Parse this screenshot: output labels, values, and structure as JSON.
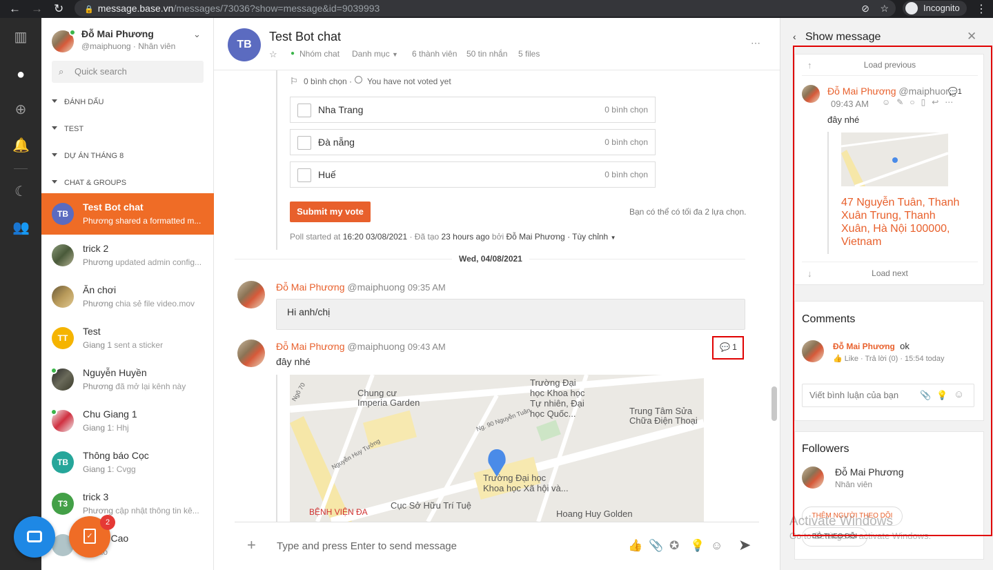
{
  "browser": {
    "url_host": "message.base.vn",
    "url_path": "/messages/73036?show=message&id=9039993",
    "incognito_label": "Incognito"
  },
  "user": {
    "name": "Đỗ Mai Phương",
    "handle": "@maiphuong · Nhân viên"
  },
  "search": {
    "placeholder": "Quick search"
  },
  "sections": [
    "ĐÁNH DẤU",
    "TEST",
    "DỰ ÁN THÁNG 8",
    "CHAT & GROUPS"
  ],
  "conversations": [
    {
      "initials": "TB",
      "name": "Test Bot chat",
      "sender": "Phương",
      "preview": " shared a formatted m...",
      "color": "#5b6bc0"
    },
    {
      "initials": "",
      "name": "trick 2",
      "sender": "Phương",
      "preview": " updated admin config...",
      "color": ""
    },
    {
      "initials": "",
      "name": "Ăn chơi",
      "sender": "Phương",
      "preview": " chia sẻ file video.mov",
      "color": ""
    },
    {
      "initials": "TT",
      "name": "Test",
      "sender": "Giang 1",
      "preview": " sent a sticker",
      "color": "#f5b400"
    },
    {
      "initials": "",
      "name": "Nguyễn Huyền",
      "sender": "Phương",
      "preview": " đã mở lại kênh này",
      "color": ""
    },
    {
      "initials": "",
      "name": "Chu Giang 1",
      "sender": "Giang 1",
      "preview": ": Hhj",
      "color": ""
    },
    {
      "initials": "TB",
      "name": "Thông báo Cọc",
      "sender": "Giang 1",
      "preview": ": Cvgg",
      "color": "#26a69a"
    },
    {
      "initials": "T3",
      "name": "trick 3",
      "sender": "Phương",
      "preview": " cập nhật thông tin kê...",
      "color": "#43a047"
    },
    {
      "initials": "",
      "name": "n Văn Cao",
      "sender": "ng",
      "preview": ": alo",
      "color": ""
    }
  ],
  "fab": {
    "badge": "2"
  },
  "chat": {
    "initials": "TB",
    "title": "Test Bot chat",
    "type": "Nhóm chat",
    "category": "Danh mục",
    "members": "6 thành viên",
    "messages": "50 tin nhắn",
    "files": "5 files"
  },
  "poll": {
    "summary_votes": "0 bình chọn ·",
    "summary_status": "You have not voted yet",
    "options": [
      {
        "label": "Nha Trang",
        "count": "0 bình chọn"
      },
      {
        "label": "Đà nẵng",
        "count": "0 bình chọn"
      },
      {
        "label": "Huế",
        "count": "0 bình chọn"
      }
    ],
    "submit": "Submit my vote",
    "hint": "Bạn có thể có tối đa 2 lựa chọn.",
    "started_prefix": "Poll started at ",
    "started_time": "16:20 03/08/2021",
    "created_prefix": " · Đã tạo ",
    "created_ago": "23 hours ago",
    "by": " bởi ",
    "author": "Đỗ Mai Phương",
    "customize": " · Tùy chỉnh"
  },
  "date_divider": "Wed, 04/08/2021",
  "messages": [
    {
      "author": "Đỗ Mai Phương",
      "handle": "@maiphuong",
      "time": "09:35 AM",
      "text": "Hi anh/chị"
    },
    {
      "author": "Đỗ Mai Phương",
      "handle": "@maiphuong",
      "time": "09:43 AM",
      "text": "đây nhé",
      "comment_count": "1"
    }
  ],
  "map_labels": {
    "a": "Chung cư\nImperia Garden",
    "b": "Trường Đại\nhọc Khoa học\nTự nhiên, Đại\nhọc Quốc...",
    "c": "Trung Tâm Sửa\nChữa Điện Thoại",
    "d": "Trường Đại học\nKhoa học Xã hội và...",
    "e": "Cục Sở Hữu Trí Tuệ",
    "f": "Hoang Huy Golden",
    "g": "BỆNH VIỆN ĐA",
    "h": "Ng. 90 Nguyễn Tuân",
    "i": "Nguyễn Huy Tưởng",
    "j": "Ngõ 70"
  },
  "composer": {
    "placeholder": "Type and press Enter to send message"
  },
  "panel": {
    "title": "Show message",
    "load_previous": "Load previous",
    "load_next": "Load next",
    "msg_author": "Đỗ Mai Phương",
    "msg_handle": "@maiphuong",
    "msg_count": "1",
    "msg_time": "09:43 AM",
    "msg_text": "đây nhé",
    "address": "47 Nguyễn Tuân, Thanh Xuân Trung, Thanh Xuân, Hà Nội 100000, Vietnam",
    "comments_title": "Comments",
    "comment_author": "Đỗ Mai Phương",
    "comment_text": "ok",
    "comment_meta": "Like · Trả lời (0) · 15:54 today",
    "comment_placeholder": "Viết bình luận của bạn",
    "followers_title": "Followers",
    "follower_name": "Đỗ Mai Phương",
    "follower_role": "Nhân viên",
    "add_follower": "THÊM NGƯỜI THEO DÕI",
    "unfollow": "BỎ THEO DÕI",
    "watermark_1": "Activate Windows",
    "watermark_2": "Go to Settings to activate Windows."
  },
  "colors": {
    "accent": "#ef6c26",
    "name": "#e8602c",
    "highlight": "#e00000"
  }
}
